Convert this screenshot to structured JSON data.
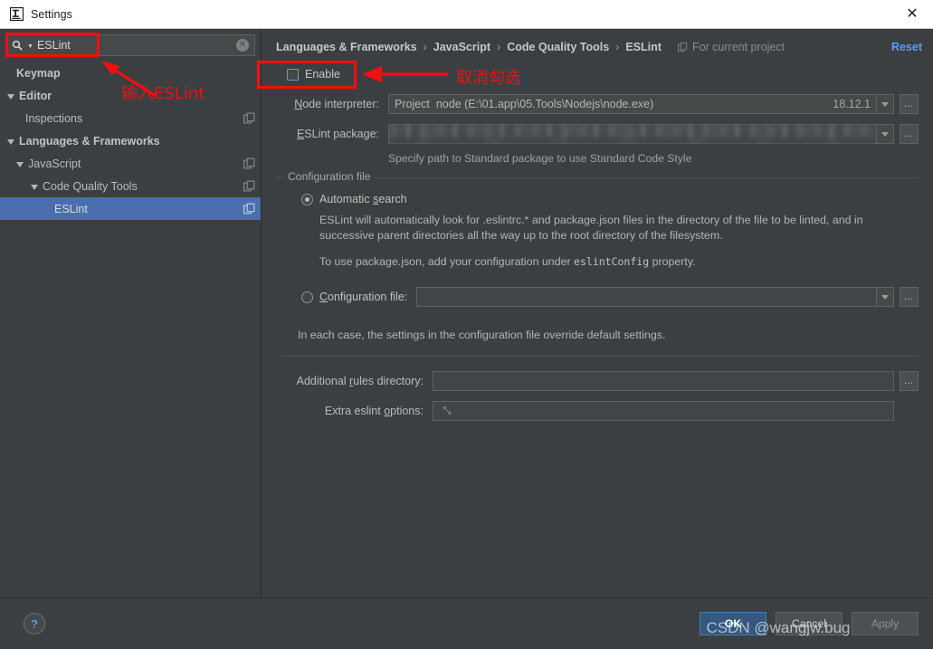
{
  "window": {
    "title": "Settings",
    "close_label": "✕",
    "app_icon": "intellij-idea-icon"
  },
  "sidebar": {
    "search": {
      "value": "ESLint",
      "placeholder": "Search settings",
      "icon": "search-icon",
      "clear_label": "✕"
    },
    "items": [
      {
        "label": "Keymap",
        "depth": 0,
        "arrow": "none",
        "bold": true,
        "selected": false,
        "badge": false
      },
      {
        "label": "Editor",
        "depth": 0,
        "arrow": "open",
        "bold": true,
        "selected": false,
        "badge": false
      },
      {
        "label": "Inspections",
        "depth": 1,
        "arrow": "none",
        "bold": false,
        "selected": false,
        "badge": true
      },
      {
        "label": "Languages & Frameworks",
        "depth": 0,
        "arrow": "open",
        "bold": true,
        "selected": false,
        "badge": false
      },
      {
        "label": "JavaScript",
        "depth": 1,
        "arrow": "open",
        "bold": false,
        "selected": false,
        "badge": true
      },
      {
        "label": "Code Quality Tools",
        "depth": 2,
        "arrow": "open",
        "bold": false,
        "selected": false,
        "badge": true
      },
      {
        "label": "ESLint",
        "depth": 3,
        "arrow": "none",
        "bold": false,
        "selected": true,
        "badge": true
      }
    ]
  },
  "breadcrumb": {
    "crumbs": [
      "Languages & Frameworks",
      "JavaScript",
      "Code Quality Tools",
      "ESLint"
    ],
    "separator": "›",
    "scope_label": "For current project",
    "scope_icon": "copy-scope-icon",
    "reset_label": "Reset"
  },
  "main": {
    "enable": {
      "label": "Enable",
      "checked": false
    },
    "node_interpreter": {
      "label": "Node interpreter:",
      "value_prefix": "Project",
      "value": "node (E:\\01.app\\05.Tools\\Nodejs\\node.exe)",
      "version": "18.12.1",
      "browse_label": "…"
    },
    "eslint_package": {
      "label": "ESLint package:",
      "value": "",
      "redacted": true,
      "browse_label": "…"
    },
    "package_hint": "Specify path to Standard package to use Standard Code Style",
    "configuration_file": {
      "group_title": "Configuration file",
      "automatic_search": {
        "label": "Automatic search",
        "selected": true
      },
      "automatic_description_1": "ESLint will automatically look for .eslintrc.* and package.json files in the directory of the file to be linted, and in successive parent directories all the way up to the root directory of the filesystem.",
      "automatic_description_2_before": "To use package.json, add your configuration under ",
      "automatic_description_2_code": "eslintConfig",
      "automatic_description_2_after": " property.",
      "config_file_option": {
        "label": "Configuration file:",
        "selected": false,
        "value": "",
        "browse_label": "…"
      },
      "footer_note": "In each case, the settings in the configuration file override default settings."
    },
    "additional_rules_directory": {
      "label": "Additional rules directory:",
      "value": "",
      "browse_label": "…"
    },
    "extra_eslint_options": {
      "label": "Extra eslint options:",
      "value": "",
      "expand_label": "⤡"
    }
  },
  "footer": {
    "help_label": "?",
    "ok_label": "OK",
    "cancel_label": "Cancel",
    "apply_label": "Apply"
  },
  "annotations": {
    "search_note": "输入ESLint",
    "enable_note": "取消勾选",
    "accent_color": "#f01010"
  },
  "watermark": {
    "text": "CSDN @wangjw.bug"
  }
}
